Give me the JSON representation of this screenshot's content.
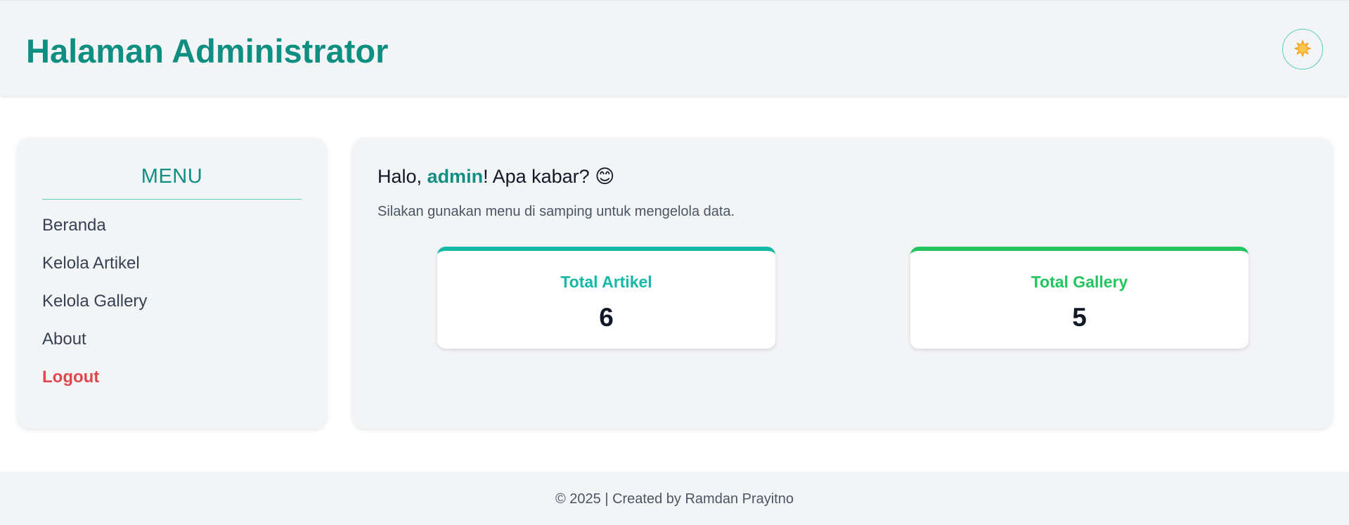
{
  "header": {
    "title": "Halaman Administrator",
    "theme_icon": "sun-icon"
  },
  "sidebar": {
    "title": "MENU",
    "items": [
      {
        "label": "Beranda"
      },
      {
        "label": "Kelola Artikel"
      },
      {
        "label": "Kelola Gallery"
      },
      {
        "label": "About"
      },
      {
        "label": "Logout"
      }
    ]
  },
  "main": {
    "greeting_prefix": "Halo, ",
    "username": "admin",
    "greeting_suffix": "! Apa kabar? ",
    "greeting_emoji": "😊",
    "subtext": "Silakan gunakan menu di samping untuk mengelola data.",
    "stats": [
      {
        "label": "Total Artikel",
        "value": "6"
      },
      {
        "label": "Total Gallery",
        "value": "5"
      }
    ]
  },
  "footer": {
    "text": "© 2025 | Created by Ramdan Prayitno"
  },
  "colors": {
    "brand": "#0f8f82",
    "artikel_accent": "#14b8a6",
    "gallery_accent": "#22c55e",
    "logout": "#e0474c",
    "panel_bg": "#f3f4f6"
  }
}
